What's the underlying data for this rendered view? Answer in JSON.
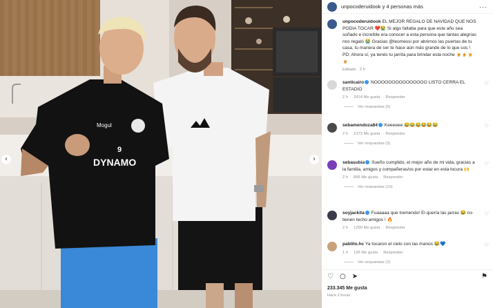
{
  "post": {
    "header_name": "unpocoderuidook y 4 personas más",
    "caption": {
      "user": "unpocoderuidook",
      "text": "EL MEJOR REGALO DE NAVIDAD QUE NOS PODIA TOCAR ❤️😭 Si algo faltaba para que este año sea soñado e increíble era conocer a esta persona que tantas alegrías nos regaló 😭 Gracias @leomessi por abrirnos las puertas de tu casa, tu manera de ser te hace aún más grande de lo que sos ! PD: Ahora sí, ya tenés tu jarrita para brindar esta noche 🍺🍺🍺🍺",
      "meta": "Editado · 2 h"
    },
    "comments": [
      {
        "user": "santicairo",
        "text": "NOOOOOOOOOOOOOOO LISTO CERRA EL ESTADIO",
        "time": "2 h",
        "likes": "2414 Me gusta",
        "reply": "Responder",
        "replies": "Ver respuestas (5)",
        "avatar_color": "#d8d8d8"
      },
      {
        "user": "sebamendoza84",
        "text": "Keeeeee 😂😂😂😂😂😂",
        "time": "2 h",
        "likes": "1373 Me gusta",
        "reply": "Responder",
        "replies": "Ver respuestas (3)",
        "avatar_color": "#4a4a4a"
      },
      {
        "user": "sebasubia",
        "text": "Sueño cumplido, el mejor año de mi vida, gracias a la familia, amigos y compañeras/os por estar en esta locura 🙌",
        "time": "2 h",
        "likes": "895 Me gusta",
        "reply": "Responder",
        "replies": "Ver respuestas (13)",
        "avatar_color": "#7a3db8"
      },
      {
        "user": "soyjackita",
        "text": "Fuaaaaa que tremendo! El quería las jarras 😂 no tienen techo amigos ! 🔥",
        "time": "2 h",
        "likes": "1290 Me gusta",
        "reply": "Responder",
        "replies": "",
        "avatar_color": "#3a3a4a"
      },
      {
        "user": "pablito.hc",
        "text": "Ya tocaron el cielo con las manos 😂💙",
        "time": "1 h",
        "likes": "136 Me gusta",
        "reply": "Responder",
        "replies": "Ver respuestas (2)",
        "avatar_color": "#c9a27a"
      }
    ],
    "likes": "233.345 Me gusta",
    "posted": "Hace 2 horas",
    "icons": [
      "heart-icon",
      "comment-icon",
      "share-icon",
      "bookmark-icon"
    ],
    "shirt": {
      "brand": "Mogul",
      "number": "9",
      "team": "DYNAMO"
    }
  }
}
